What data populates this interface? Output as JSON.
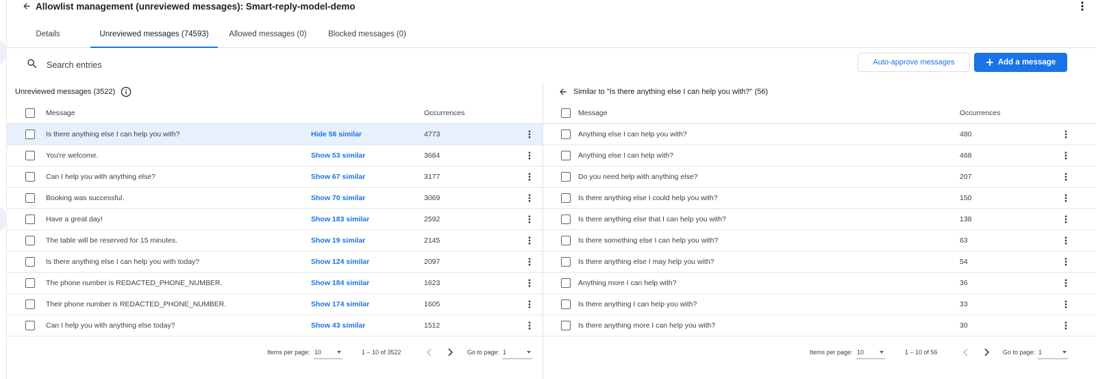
{
  "header": {
    "title": "Allowlist management (unreviewed messages): Smart-reply-model-demo"
  },
  "tabs": [
    {
      "label": "Details"
    },
    {
      "label": "Unreviewed messages (74593)"
    },
    {
      "label": "Allowed messages (0)"
    },
    {
      "label": "Blocked messages (0)"
    }
  ],
  "toolbar": {
    "search_placeholder": "Search entries",
    "auto_approve_label": "Auto-approve messages",
    "add_message_label": "Add a message"
  },
  "colors": {
    "accent": "#1a73e8",
    "selected_row": "#e8f0fe"
  },
  "left_panel": {
    "title": "Unreviewed messages (3522)",
    "columns": {
      "message": "Message",
      "occurrences": "Occurrences"
    },
    "rows": [
      {
        "message": "Is there anything else I can help you with?",
        "similar": "Hide 56 similar",
        "occurrences": "4773"
      },
      {
        "message": "You're welcome.",
        "similar": "Show 53 similar",
        "occurrences": "3684"
      },
      {
        "message": "Can I help you with anything else?",
        "similar": "Show 67 similar",
        "occurrences": "3177"
      },
      {
        "message": "Booking was successful.",
        "similar": "Show 70 similar",
        "occurrences": "3069"
      },
      {
        "message": "Have a great day!",
        "similar": "Show 183 similar",
        "occurrences": "2592"
      },
      {
        "message": "The table will be reserved for 15 minutes.",
        "similar": "Show 19 similar",
        "occurrences": "2145"
      },
      {
        "message": "Is there anything else I can help you with today?",
        "similar": "Show 124 similar",
        "occurrences": "2097"
      },
      {
        "message": "The phone number is REDACTED_PHONE_NUMBER.",
        "similar": "Show 184 similar",
        "occurrences": "1623"
      },
      {
        "message": "Their phone number is REDACTED_PHONE_NUMBER.",
        "similar": "Show 174 similar",
        "occurrences": "1605"
      },
      {
        "message": "Can I help you with anything else today?",
        "similar": "Show 43 similar",
        "occurrences": "1512"
      }
    ],
    "pagination": {
      "items_per_page_label": "Items per page:",
      "items_per_page": "10",
      "range": "1 – 10 of 3522",
      "go_to_page_label": "Go to page:",
      "page": "1"
    }
  },
  "right_panel": {
    "title": "Similar to \"Is there anything else I can help you with?\" (56)",
    "columns": {
      "message": "Message",
      "occurrences": "Occurrences"
    },
    "rows": [
      {
        "message": "Anything else I can help you with?",
        "occurrences": "480"
      },
      {
        "message": "Anything else I can help with?",
        "occurrences": "468"
      },
      {
        "message": "Do you need help with anything else?",
        "occurrences": "207"
      },
      {
        "message": "Is there anything else I could help you with?",
        "occurrences": "150"
      },
      {
        "message": "Is there anything else that I can help you with?",
        "occurrences": "138"
      },
      {
        "message": "Is there something else I can help you with?",
        "occurrences": "63"
      },
      {
        "message": "Is there anything else I may help you with?",
        "occurrences": "54"
      },
      {
        "message": "Anything more I can help with?",
        "occurrences": "36"
      },
      {
        "message": "Is there anything I can help you with?",
        "occurrences": "33"
      },
      {
        "message": "Is there anything more I can help you with?",
        "occurrences": "30"
      }
    ],
    "pagination": {
      "items_per_page_label": "Items per page:",
      "items_per_page": "10",
      "range": "1 – 10 of 56",
      "go_to_page_label": "Go to page:",
      "page": "1"
    }
  }
}
